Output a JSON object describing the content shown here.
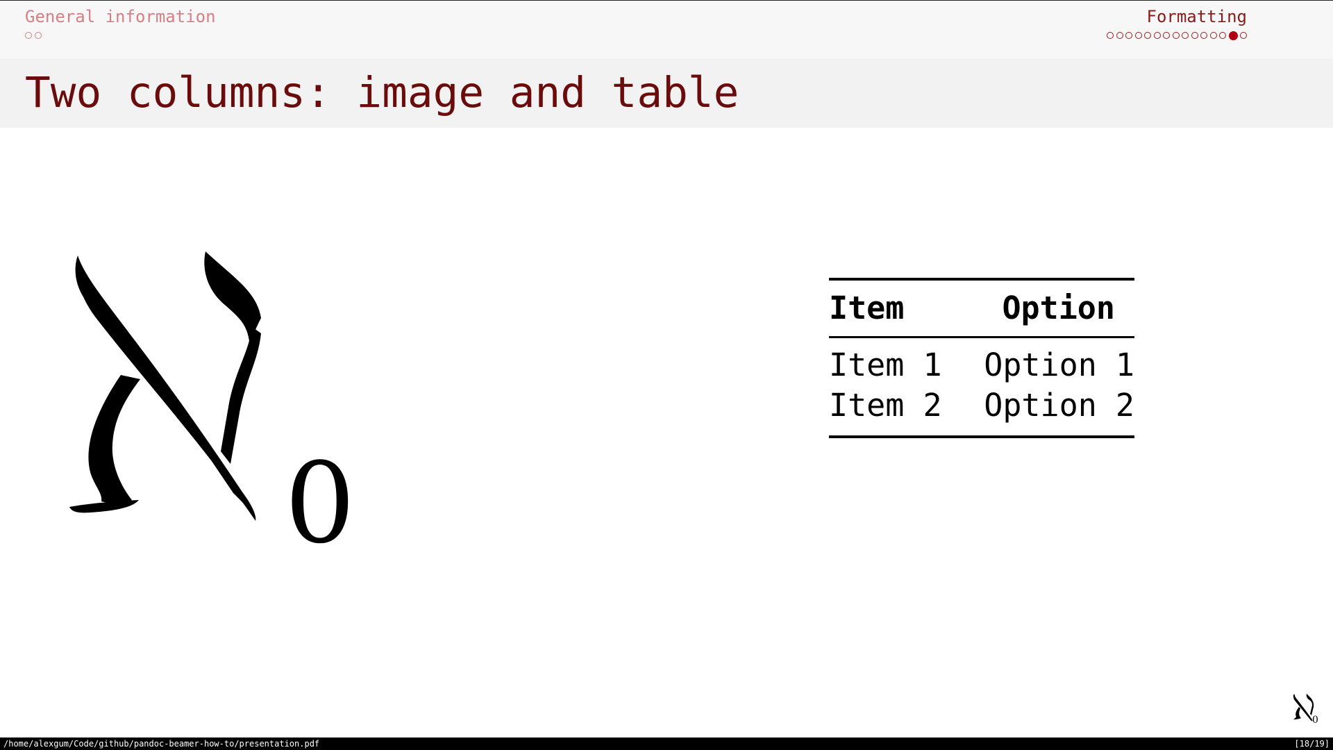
{
  "header": {
    "left_section": {
      "label": "General information",
      "frame_count": 2,
      "current_index": -1
    },
    "right_section": {
      "label": "Formatting",
      "frame_count": 15,
      "current_index": 13
    }
  },
  "frame": {
    "title": "Two columns: image and table",
    "figure": {
      "subscript": "0"
    },
    "table": {
      "headers": [
        "Item",
        "Option"
      ],
      "rows": [
        [
          "Item 1",
          "Option 1"
        ],
        [
          "Item 2",
          "Option 2"
        ]
      ]
    }
  },
  "corner_logo": {
    "subscript": "0"
  },
  "statusbar": {
    "path": "/home/alexgum/Code/github/pandoc-beamer-how-to/presentation.pdf",
    "page": "[18/19]"
  },
  "colors": {
    "title": "#6b0c0c",
    "section_inactive": "#d77f86",
    "section_active": "#8b1a1a",
    "dot_active": "#b00010"
  }
}
